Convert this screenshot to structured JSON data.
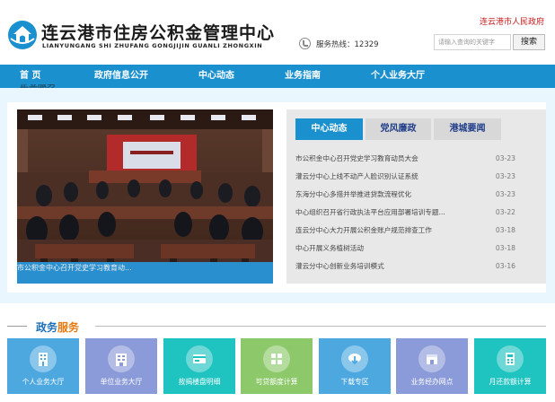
{
  "header": {
    "title_cn": "连云港市住房公积金管理中心",
    "title_en": "LIANYUNGANG SHI ZHUFANG GONGJIJIN GUANLI ZHONGXIN",
    "gov_link": "连云港市人民政府",
    "hotline_label": "服务热线：12329",
    "search_placeholder": "请输入查询的关键字",
    "search_button": "搜索"
  },
  "nav": {
    "items": [
      "首 页",
      "政府信息公开",
      "中心动态",
      "业务指南",
      "个人业务大厅"
    ],
    "overflow_text": "企业服务"
  },
  "slider": {
    "caption": "市公积金中心召开党史学习教育动..."
  },
  "news": {
    "tabs": [
      "中心动态",
      "党风廉政",
      "港城要闻"
    ],
    "active_tab": 0,
    "items": [
      {
        "title": "市公积金中心召开党史学习教育动员大会",
        "date": "03-23"
      },
      {
        "title": "灌云分中心上线不动产人脸识别认证系统",
        "date": "03-23"
      },
      {
        "title": "东海分中心多措并举推进贷款流程优化",
        "date": "03-23"
      },
      {
        "title": "中心组织召开省行政执法平台应用部署培训专题...",
        "date": "03-22"
      },
      {
        "title": "连云分中心大力开展公积金账户规范排查工作",
        "date": "03-18"
      },
      {
        "title": "中心开展义务植树活动",
        "date": "03-18"
      },
      {
        "title": "灌云分中心创新业务培训模式",
        "date": "03-16"
      }
    ]
  },
  "services": {
    "title_a": "政务",
    "title_b": "服务",
    "items": [
      {
        "label": "个人业务大厅",
        "color": "#4ea8e0",
        "icon": "building-icon"
      },
      {
        "label": "单位业务大厅",
        "color": "#8b9ad8",
        "icon": "office-icon"
      },
      {
        "label": "按揭楼盘明细",
        "color": "#1fc3c0",
        "icon": "card-icon"
      },
      {
        "label": "可贷额度计算",
        "color": "#8dc96a",
        "icon": "grid-icon"
      },
      {
        "label": "下载专区",
        "color": "#4ea8e0",
        "icon": "download-icon"
      },
      {
        "label": "业务经办网点",
        "color": "#8b9ad8",
        "icon": "location-icon"
      },
      {
        "label": "月还款额计算",
        "color": "#1fc3c0",
        "icon": "calculator-icon"
      }
    ]
  },
  "colors": {
    "nav_blue": "#1b90cf",
    "accent_red": "#c81c1c",
    "accent_orange": "#e67a10"
  }
}
